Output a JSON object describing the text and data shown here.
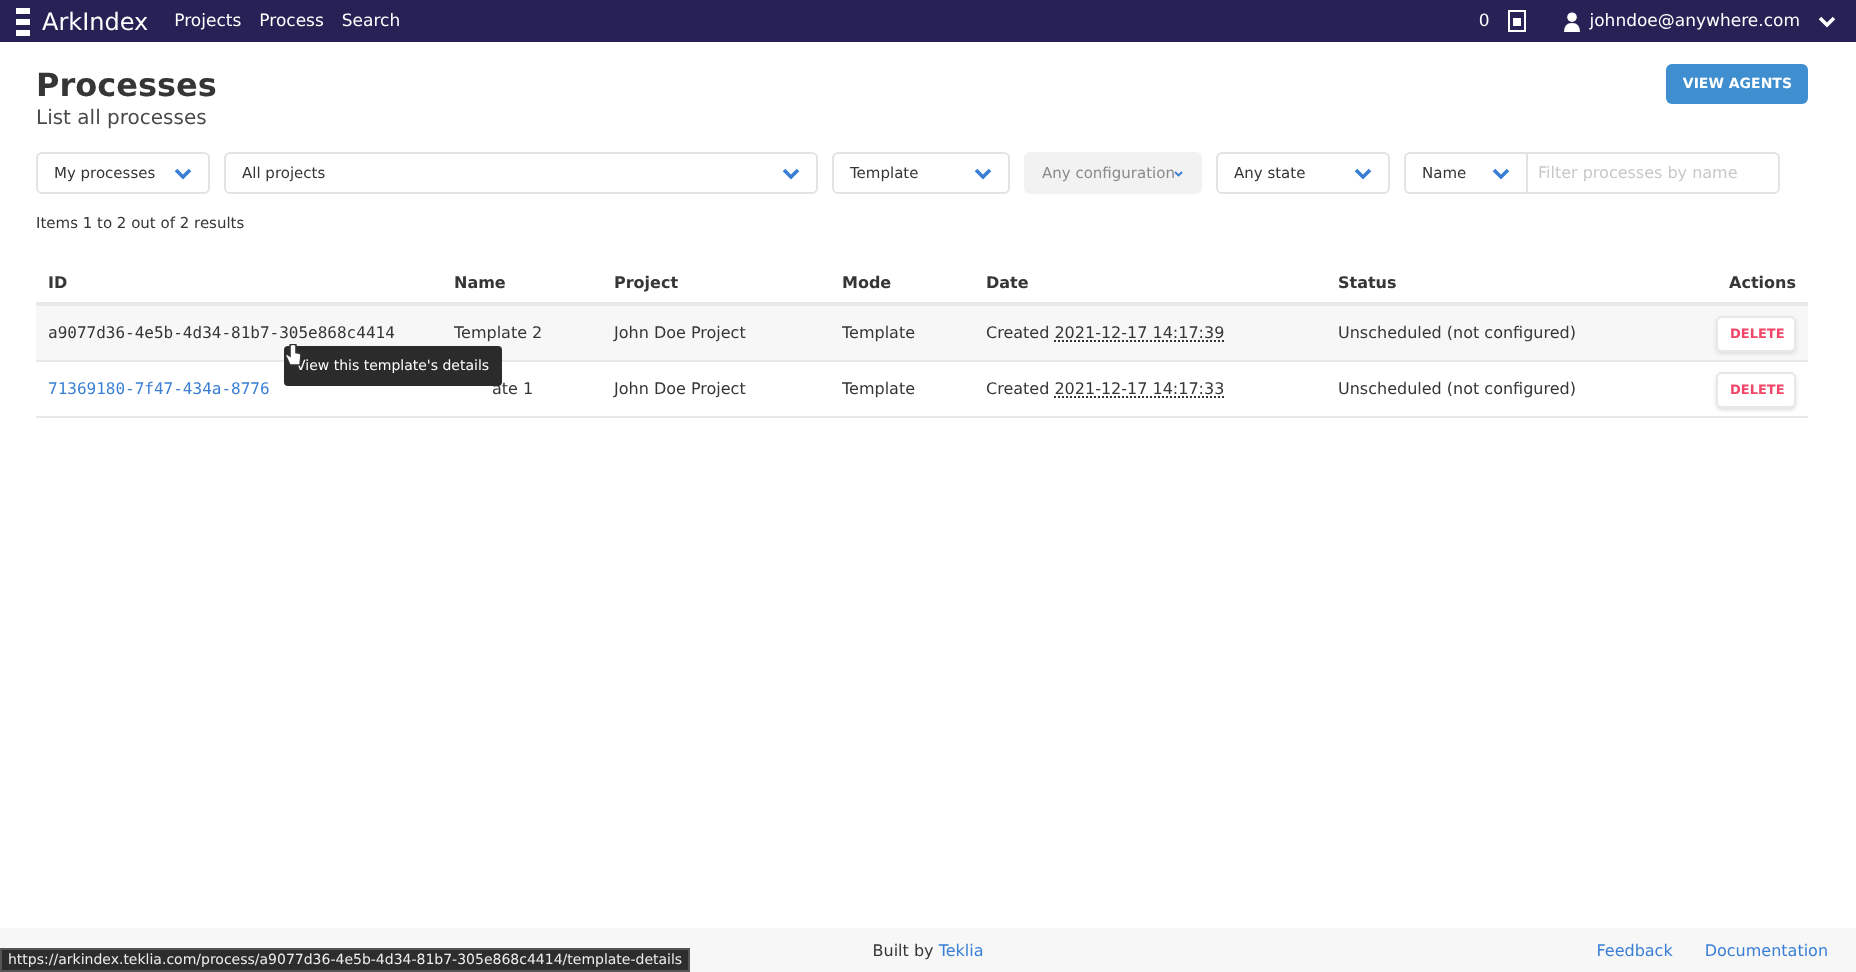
{
  "navbar": {
    "brand": "ArkIndex",
    "links": [
      "Projects",
      "Process",
      "Search"
    ],
    "jobs_count": "0",
    "user": "johndoe@anywhere.com"
  },
  "header": {
    "title": "Processes",
    "subtitle": "List all processes",
    "button": "VIEW AGENTS"
  },
  "filters": [
    {
      "kind": "select",
      "value": "My processes",
      "disabled": false
    },
    {
      "kind": "select",
      "value": "All projects",
      "disabled": false
    },
    {
      "kind": "select",
      "value": "Template",
      "disabled": false
    },
    {
      "kind": "select",
      "value": "Any configuration",
      "disabled": true
    },
    {
      "kind": "select",
      "value": "Any state",
      "disabled": false
    },
    {
      "kind": "search",
      "value": "Name",
      "placeholder": "Filter processes by name"
    }
  ],
  "results": "Items 1 to 2 out of 2 results",
  "table": {
    "columns": [
      "ID",
      "Name",
      "Project",
      "Mode",
      "Date",
      "Status",
      "Actions"
    ],
    "rows": [
      {
        "id": "a9077d36-4e5b-4d34-81b7-305e868c4414",
        "link": false,
        "hovered": true,
        "name": "Template 2",
        "name_covered": false,
        "project": "John Doe Project",
        "mode": "Template",
        "created": "Created",
        "date": "2021-12-17 14:17:39",
        "status": "Unscheduled (not configured)",
        "action": "DELETE"
      },
      {
        "id": "71369180-7f47-434a-8776",
        "link": true,
        "hovered": false,
        "name": "ate 1",
        "name_covered": true,
        "project": "John Doe Project",
        "mode": "Template",
        "created": "Created",
        "date": "2021-12-17 14:17:33",
        "status": "Unscheduled (not configured)",
        "action": "DELETE"
      }
    ]
  },
  "tooltip": "View this template's details",
  "footer": {
    "built_by": "Built by",
    "company": "Teklia",
    "links": [
      "Feedback",
      "Documentation"
    ]
  },
  "status_url": "https://arkindex.teklia.com/process/a9077d36-4e5b-4d34-81b7-305e868c4414/template-details"
}
